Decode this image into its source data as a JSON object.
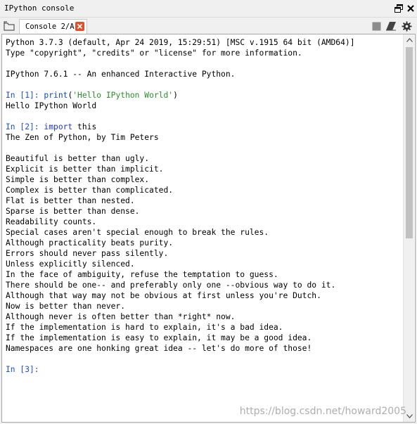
{
  "window": {
    "title": "IPython console"
  },
  "tabs": [
    {
      "label": "Console 2/A",
      "active": true
    }
  ],
  "console": {
    "banner": [
      "Python 3.7.3 (default, Apr 24 2019, 15:29:51) [MSC v.1915 64 bit (AMD64)]",
      "Type \"copyright\", \"credits\" or \"license\" for more information.",
      "",
      "IPython 7.6.1 -- An enhanced Interactive Python."
    ],
    "cells": [
      {
        "prompt": "In [1]: ",
        "code_parts": [
          {
            "text": "print",
            "cls": "kw-builtin"
          },
          {
            "text": "(",
            "cls": ""
          },
          {
            "text": "'Hello IPython World'",
            "cls": "str"
          },
          {
            "text": ")",
            "cls": ""
          }
        ],
        "output": [
          "Hello IPython World"
        ]
      },
      {
        "prompt": "In [2]: ",
        "code_parts": [
          {
            "text": "import",
            "cls": "kw"
          },
          {
            "text": " this",
            "cls": ""
          }
        ],
        "output": [
          "The Zen of Python, by Tim Peters",
          "",
          "Beautiful is better than ugly.",
          "Explicit is better than implicit.",
          "Simple is better than complex.",
          "Complex is better than complicated.",
          "Flat is better than nested.",
          "Sparse is better than dense.",
          "Readability counts.",
          "Special cases aren't special enough to break the rules.",
          "Although practicality beats purity.",
          "Errors should never pass silently.",
          "Unless explicitly silenced.",
          "In the face of ambiguity, refuse the temptation to guess.",
          "There should be one-- and preferably only one --obvious way to do it.",
          "Although that way may not be obvious at first unless you're Dutch.",
          "Now is better than never.",
          "Although never is often better than *right* now.",
          "If the implementation is hard to explain, it's a bad idea.",
          "If the implementation is easy to explain, it may be a good idea.",
          "Namespaces are one honking great idea -- let's do more of those!"
        ]
      },
      {
        "prompt": "In [3]: ",
        "code_parts": [],
        "output": []
      }
    ]
  },
  "watermark": "https://blog.csdn.net/howard2005",
  "icons": {
    "undock": "undock-icon",
    "close_pane": "close-pane-icon",
    "browse_tabs": "browse-tabs-icon",
    "tab_close": "tab-close-icon",
    "stop": "stop-icon",
    "clear": "eraser-icon",
    "options": "gear-icon"
  },
  "colors": {
    "prompt": "#1c4fd8",
    "string": "#2a8f2a",
    "keyword": "#1f33d6",
    "tab_close_bg": "#e2502a"
  }
}
